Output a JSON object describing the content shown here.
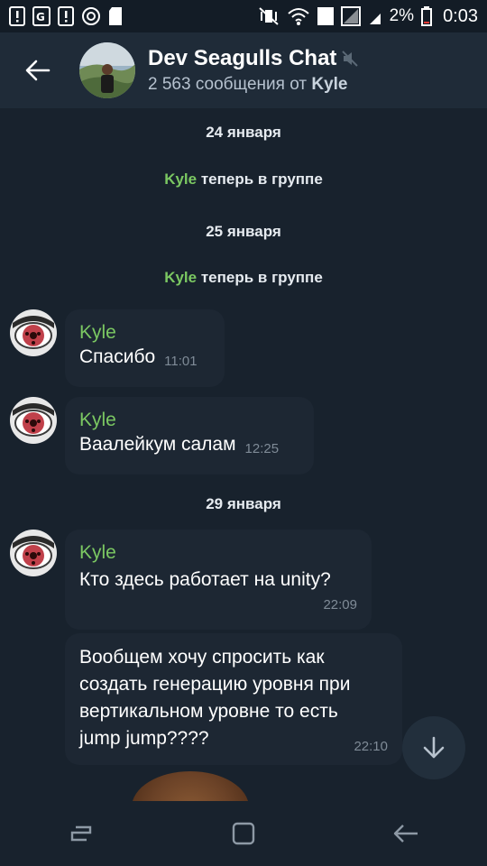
{
  "status_bar": {
    "battery_percent": "2%",
    "time": "0:03",
    "sim_badge": "1"
  },
  "header": {
    "title": "Dev Seagulls Chat",
    "subtitle_count": "2 563 сообщения от",
    "subtitle_user": "Kyle"
  },
  "messages": {
    "dates": [
      "24 января",
      "25 января",
      "29 января"
    ],
    "service_actor": "Kyle",
    "service_text": " теперь в группе",
    "items": [
      {
        "sender": "Kyle",
        "text": "Спасибо",
        "time": "11:01"
      },
      {
        "sender": "Kyle",
        "text": "Ваалейкум салам",
        "time": "12:25"
      },
      {
        "sender": "Kyle",
        "text": "Кто здесь работает на unity?",
        "time": "22:09"
      },
      {
        "sender": "",
        "text": "Вообщем хочу спросить как создать генерацию уровня при вертикальном уровне то есть jump jump????",
        "time": "22:10"
      }
    ]
  },
  "colors": {
    "background": "#18222d",
    "header": "#1f2b38",
    "bubble": "#1d2733",
    "sender_name": "#7bc862",
    "time": "#7f8b97"
  },
  "icons": {
    "back": "arrow-left-icon",
    "muted": "muted-speaker-icon",
    "scroll_down": "arrow-down-icon",
    "nav_recent": "recents-icon",
    "nav_home": "home-icon",
    "nav_back": "back-icon"
  }
}
